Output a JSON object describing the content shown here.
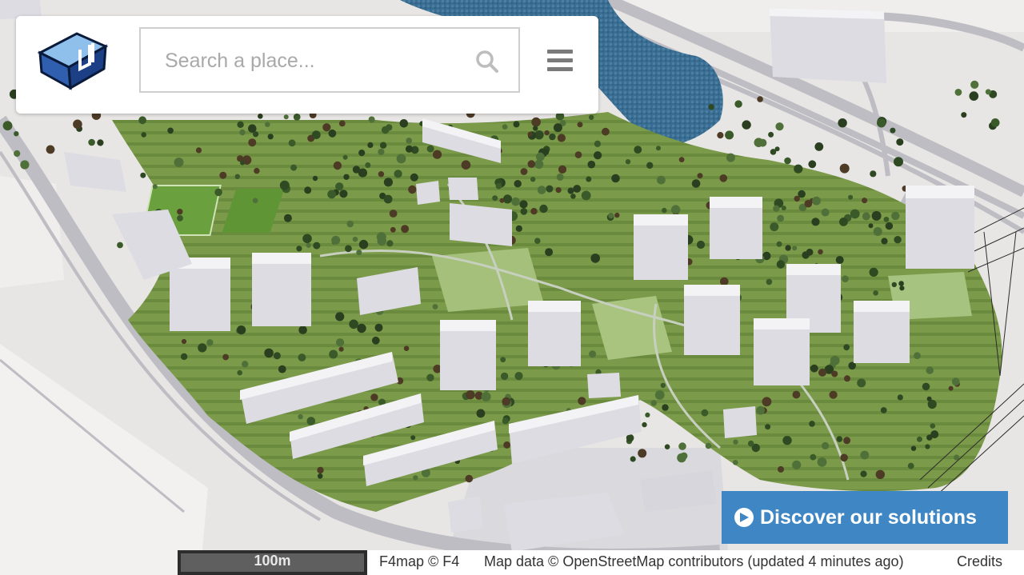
{
  "header": {
    "search": {
      "placeholder": "Search a place...",
      "value": ""
    }
  },
  "icons": {
    "logo": "f4-cube-logo",
    "search": "magnifier-icon",
    "menu": "hamburger-icon",
    "discover": "arrow-circle-right-icon"
  },
  "cta": {
    "label": "Discover our solutions"
  },
  "scale": {
    "label": "100m"
  },
  "attribution": {
    "f4map": "F4map © F4",
    "mapdata": "Map data © OpenStreetMap contributors (updated 4 minutes ago)",
    "credits": "Credits"
  },
  "colors": {
    "accent": "#3f86c5",
    "park": "#7e9a4c",
    "water": "#3b6f94",
    "building": "#e9e9ec",
    "ground": "#e6e4e2"
  }
}
